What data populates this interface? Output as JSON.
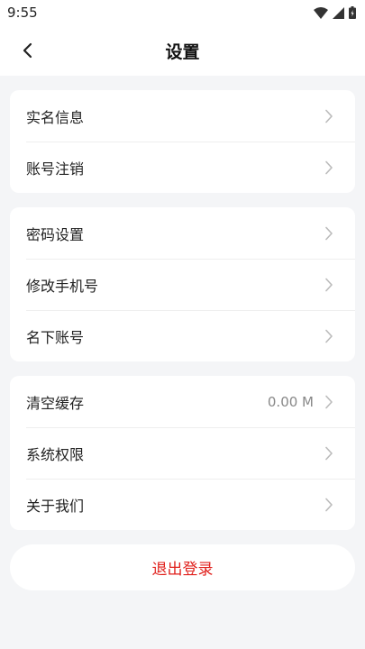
{
  "status_bar": {
    "time": "9:55",
    "icons": [
      "wifi-icon",
      "signal-icon",
      "battery-icon"
    ]
  },
  "header": {
    "back_icon": "chevron-left-icon",
    "title": "设置"
  },
  "groups": [
    {
      "items": [
        {
          "label": "实名信息"
        },
        {
          "label": "账号注销"
        }
      ]
    },
    {
      "items": [
        {
          "label": "密码设置"
        },
        {
          "label": "修改手机号"
        },
        {
          "label": "名下账号"
        }
      ]
    },
    {
      "items": [
        {
          "label": "清空缓存",
          "value": "0.00 M"
        },
        {
          "label": "系统权限"
        },
        {
          "label": "关于我们"
        }
      ]
    }
  ],
  "logout": {
    "label": "退出登录"
  },
  "colors": {
    "background": "#f4f5f7",
    "card": "#ffffff",
    "logout_text": "#e0201c",
    "chevron": "#bbbbbb"
  }
}
